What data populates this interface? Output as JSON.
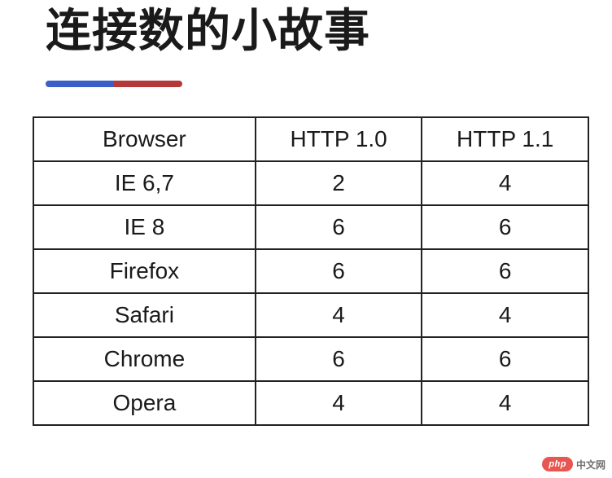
{
  "title": "连接数的小故事",
  "chart_data": {
    "type": "table",
    "title": "连接数的小故事",
    "columns": [
      "Browser",
      "HTTP 1.0",
      "HTTP 1.1"
    ],
    "rows": [
      {
        "browser": "IE 6,7",
        "http10": 2,
        "http11": 4
      },
      {
        "browser": "IE 8",
        "http10": 6,
        "http11": 6
      },
      {
        "browser": "Firefox",
        "http10": 6,
        "http11": 6
      },
      {
        "browser": "Safari",
        "http10": 4,
        "http11": 4
      },
      {
        "browser": "Chrome",
        "http10": 6,
        "http11": 6
      },
      {
        "browser": "Opera",
        "http10": 4,
        "http11": 4
      }
    ]
  },
  "watermark": {
    "badge": "php",
    "text": "中文网"
  }
}
